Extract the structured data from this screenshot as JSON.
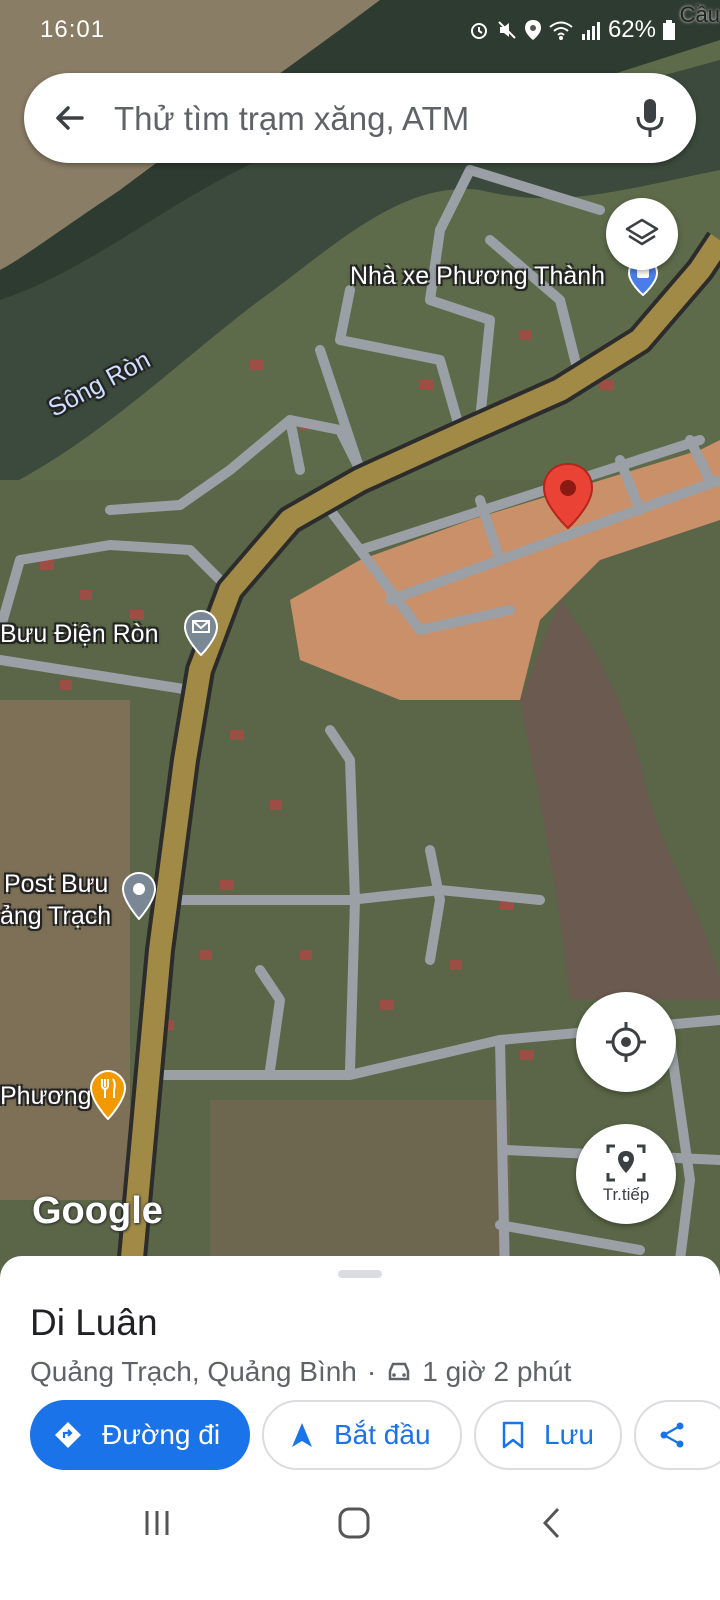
{
  "status_bar": {
    "time": "16:01",
    "battery": "62%",
    "corner_label": "Cầu"
  },
  "search": {
    "placeholder": "Thử tìm trạm xăng, ATM"
  },
  "map": {
    "river_label": "Sông Ròn",
    "pois": [
      {
        "name": "Nhà xe Phương Thành",
        "icon": "bus-pin-icon"
      },
      {
        "name": "Bưu Điện Ròn",
        "icon": "mail-pin-icon"
      },
      {
        "name_line1": "Post Bưu",
        "name_line2": "ảng Trạch",
        "icon": "location-pin-icon"
      },
      {
        "name": "Phương",
        "icon": "restaurant-pin-icon"
      }
    ],
    "selected_marker": "red-location-marker",
    "attribution": "Google"
  },
  "controls": {
    "layers_icon": "layers-icon",
    "locate_icon": "my-location-icon",
    "next_label": "Tr.tiếp"
  },
  "place": {
    "name": "Di Luân",
    "region": "Quảng Trạch, Quảng Bình",
    "separator": "·",
    "drive_time": "1 giờ 2 phút"
  },
  "actions": {
    "directions": "Đường đi",
    "start": "Bắt đầu",
    "save": "Lưu"
  },
  "colors": {
    "accent": "#1a73e8",
    "marker": "#ea4335",
    "road_main": "#a08a45"
  }
}
